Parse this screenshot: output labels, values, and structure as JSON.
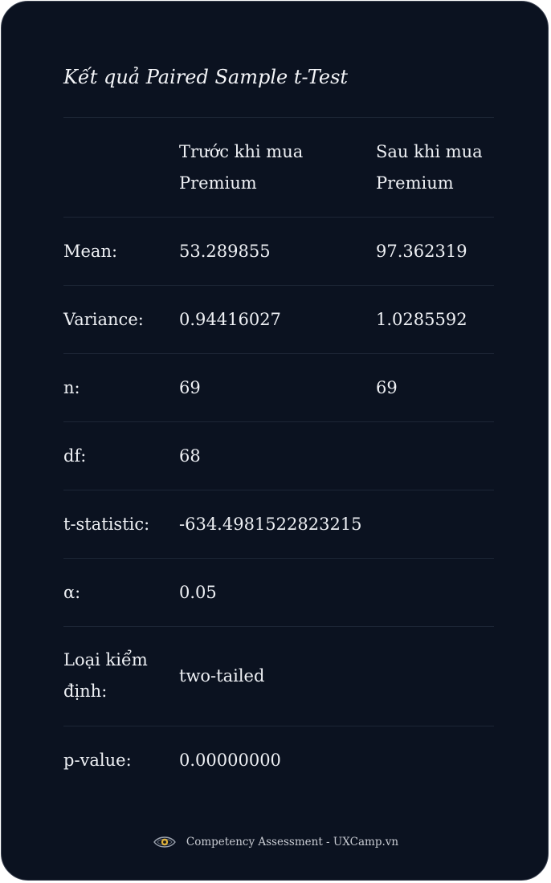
{
  "title": "Kết quả Paired Sample t-Test",
  "table": {
    "headers": [
      "",
      "Trước khi mua Premium",
      "Sau khi mua Premium"
    ],
    "header_lines": {
      "col2": [
        "Trước khi mua",
        "Premium"
      ],
      "col3": [
        "Sau khi mua",
        "Premium"
      ]
    },
    "rows": [
      {
        "label": "Mean:",
        "before": "53.289855",
        "after": "97.362319"
      },
      {
        "label": "Variance:",
        "before": "0.94416027",
        "after": "1.0285592"
      },
      {
        "label": "n:",
        "before": "69",
        "after": "69"
      },
      {
        "label": "df:",
        "before": "68",
        "after": ""
      },
      {
        "label": "t-statistic:",
        "before": "-634.4981522823215",
        "after": ""
      },
      {
        "label": "α:",
        "before": "0.05",
        "after": ""
      },
      {
        "label": "Loại kiểm định:",
        "label_lines": [
          "Loại kiểm",
          "định:"
        ],
        "before": "two-tailed",
        "after": ""
      },
      {
        "label": "p-value:",
        "before": "0.00000000",
        "after": ""
      }
    ]
  },
  "footer": {
    "text": "Competency Assessment - UXCamp.vn",
    "icon": "eye-logo-icon"
  },
  "colors": {
    "background": "#0b1220",
    "text": "#eef0f4",
    "divider": "#1d2636",
    "accent": "#e0b23a"
  }
}
